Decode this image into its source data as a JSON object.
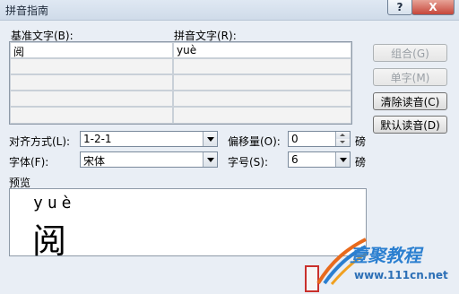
{
  "window": {
    "title": "拼音指南",
    "help_glyph": "?",
    "close_glyph": "X"
  },
  "table": {
    "base_label": "基准文字(B):",
    "ruby_label": "拼音文字(R):",
    "rows": [
      {
        "base": "阅",
        "ruby": "yuè"
      },
      {
        "base": "",
        "ruby": ""
      },
      {
        "base": "",
        "ruby": ""
      },
      {
        "base": "",
        "ruby": ""
      },
      {
        "base": "",
        "ruby": ""
      }
    ]
  },
  "buttons": {
    "combine": "组合(G)",
    "mono": "单字(M)",
    "clear": "清除读音(C)",
    "default": "默认读音(D)"
  },
  "options": {
    "alignment_label": "对齐方式(L):",
    "alignment_value": "1-2-1",
    "offset_label": "偏移量(O):",
    "offset_value": "0",
    "offset_unit": "磅",
    "font_label": "字体(F):",
    "font_value": "宋体",
    "size_label": "字号(S):",
    "size_value": "6",
    "size_unit": "磅"
  },
  "preview": {
    "label": "预览",
    "pinyin": "yuè",
    "char": "阅"
  },
  "watermark": {
    "brand": "壹聚教程",
    "url": "www.111cn.net"
  }
}
